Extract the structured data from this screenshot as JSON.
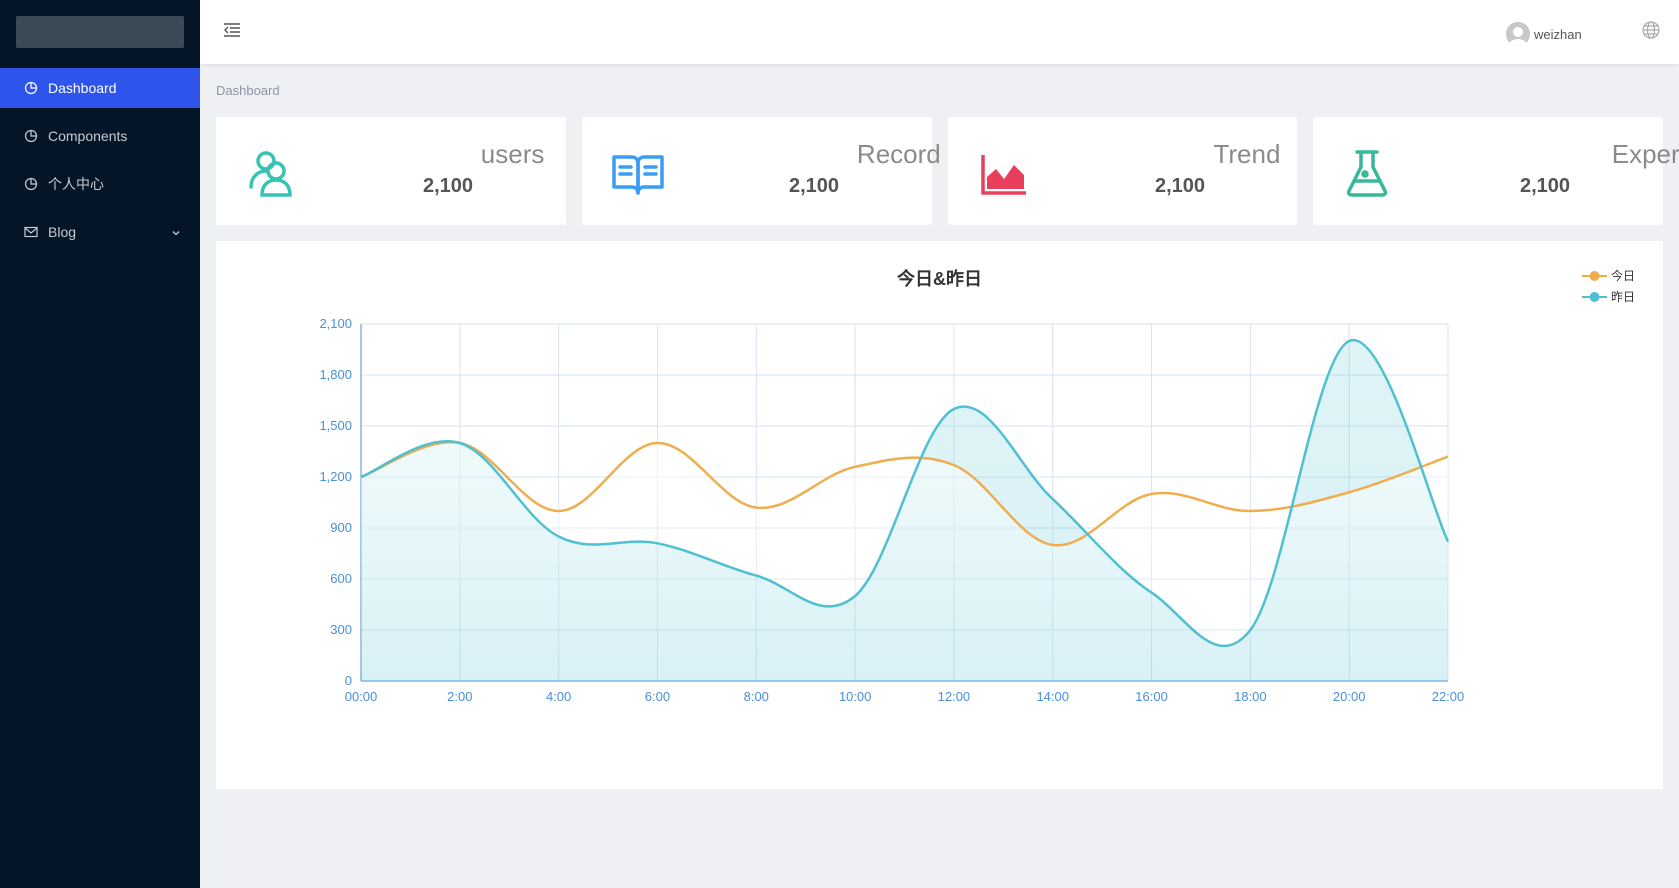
{
  "sidebar": {
    "items": [
      {
        "label": "Dashboard",
        "icon": "pie-chart-icon",
        "active": true
      },
      {
        "label": "Components",
        "icon": "pie-chart-icon",
        "active": false
      },
      {
        "label": "个人中心",
        "icon": "pie-chart-icon",
        "active": false
      },
      {
        "label": "Blog",
        "icon": "mail-icon",
        "active": false,
        "has_submenu": true
      }
    ]
  },
  "header": {
    "user_name": "weizhan"
  },
  "breadcrumb": "Dashboard",
  "cards": [
    {
      "title": "users",
      "value": "2,100",
      "icon": "users-icon",
      "color": "#36c3b4"
    },
    {
      "title": "Record",
      "value": "2,100",
      "icon": "book-icon",
      "color": "#3a9df5"
    },
    {
      "title": "Trend",
      "value": "2,100",
      "icon": "area-chart-icon",
      "color": "#e8405c"
    },
    {
      "title": "Experiment",
      "value": "2,100",
      "icon": "flask-icon",
      "color": "#36b89a"
    }
  ],
  "chart_data": {
    "type": "line",
    "title": "今日&昨日",
    "categories": [
      "00:00",
      "2:00",
      "4:00",
      "6:00",
      "8:00",
      "10:00",
      "12:00",
      "14:00",
      "16:00",
      "18:00",
      "20:00",
      "22:00"
    ],
    "series": [
      {
        "name": "今日",
        "color": "#f0ad4e",
        "values": [
          1200,
          1400,
          1000,
          1400,
          1020,
          1260,
          1270,
          800,
          1100,
          1000,
          1110,
          1320
        ]
      },
      {
        "name": "昨日",
        "color": "#4ec0d2",
        "values": [
          1200,
          1400,
          850,
          810,
          620,
          500,
          1600,
          1070,
          520,
          300,
          2000,
          820
        ]
      }
    ],
    "ylim": [
      0,
      2100
    ],
    "yticks": [
      "0",
      "300",
      "600",
      "900",
      "1,200",
      "1,500",
      "1,800",
      "2,100"
    ],
    "grid": true,
    "legend_position": "top-right"
  }
}
